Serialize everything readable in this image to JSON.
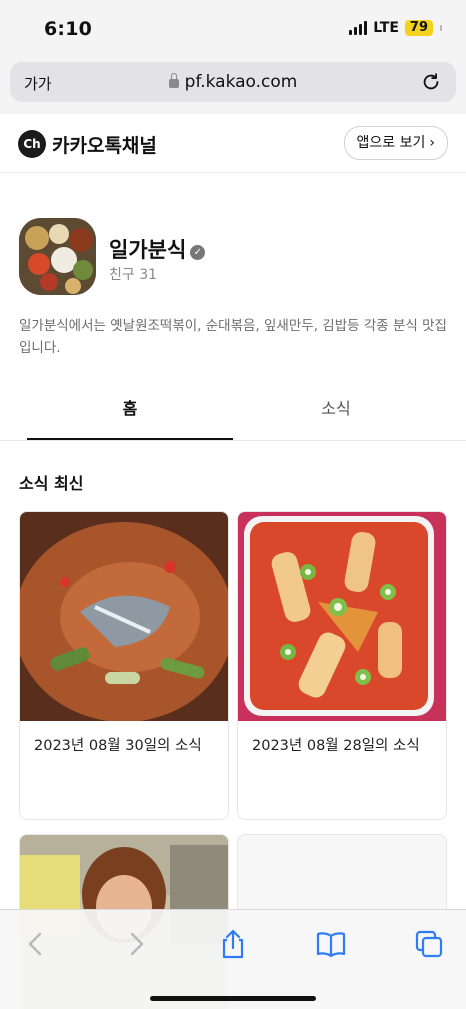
{
  "status": {
    "time": "6:10",
    "network": "LTE",
    "battery": "79"
  },
  "browser": {
    "text_size_label": "가가",
    "url": "pf.kakao.com"
  },
  "channel_header": {
    "logo_text": "Ch",
    "title": "카카오톡채널",
    "open_app_label": "앱으로 보기",
    "open_app_chevron": "›"
  },
  "profile": {
    "name": "일가분식",
    "verified_mark": "✓",
    "friends": "친구 31",
    "description": "일가분식에서는 옛날원조떡볶이, 순대볶음, 잎새만두, 김밥등 각종 분식 맛집입니다."
  },
  "tabs": [
    {
      "label": "홈",
      "active": true
    },
    {
      "label": "소식",
      "active": false
    }
  ],
  "section": {
    "title": "소식 최신",
    "posts": [
      {
        "caption": "2023년 08월 30일의 소식"
      },
      {
        "caption": "2023년 08월 28일의 소식"
      }
    ]
  },
  "toolbar": {
    "icons": [
      "back-icon",
      "forward-icon",
      "share-icon",
      "bookmarks-icon",
      "tabs-icon"
    ]
  }
}
